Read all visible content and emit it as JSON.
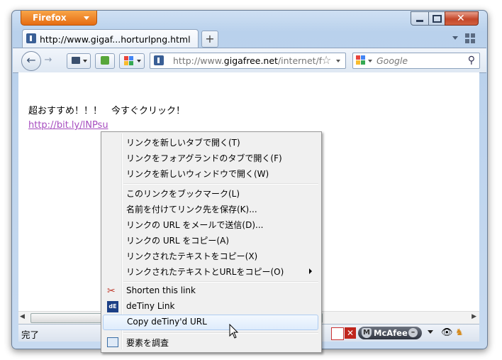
{
  "browser": {
    "app_button": "Firefox",
    "tab_title": "http://www.gigaf...horturlpng.html",
    "new_tab": "+",
    "url_prefix": "http://www.",
    "url_domain": "gigafree.net",
    "url_rest": "/internet/f",
    "search_placeholder": "Google",
    "status_text": "完了",
    "addon_label": "McAfee"
  },
  "page": {
    "message": "超おすすめ！！！　今すぐクリック！",
    "link": "http://bit.ly/lNPsu"
  },
  "context_menu": {
    "items": [
      {
        "label": "リンクを新しいタブで開く(T)"
      },
      {
        "label": "リンクをフォアグランドのタブで開く(F)"
      },
      {
        "label": "リンクを新しいウィンドウで開く(W)"
      },
      {
        "label": "このリンクをブックマーク(L)"
      },
      {
        "label": "名前を付けてリンク先を保存(K)..."
      },
      {
        "label": "リンクの URL をメールで送信(D)..."
      },
      {
        "label": "リンクの URL をコピー(A)"
      },
      {
        "label": "リンクされたテキストをコピー(X)"
      },
      {
        "label": "リンクされたテキストとURLをコピー(O)",
        "submenu": true
      },
      {
        "label": "Shorten this link",
        "icon": "scissors-icon"
      },
      {
        "label": "deTiny Link",
        "icon": "detiny-icon"
      },
      {
        "label": "Copy deTiny'd URL",
        "highlighted": true
      },
      {
        "label": "要素を調査",
        "icon": "inspect-icon"
      }
    ]
  },
  "colors": {
    "firefox_orange": "#e66c12",
    "link_visited": "#a64cbf",
    "menu_highlight": "#dfecfc"
  }
}
